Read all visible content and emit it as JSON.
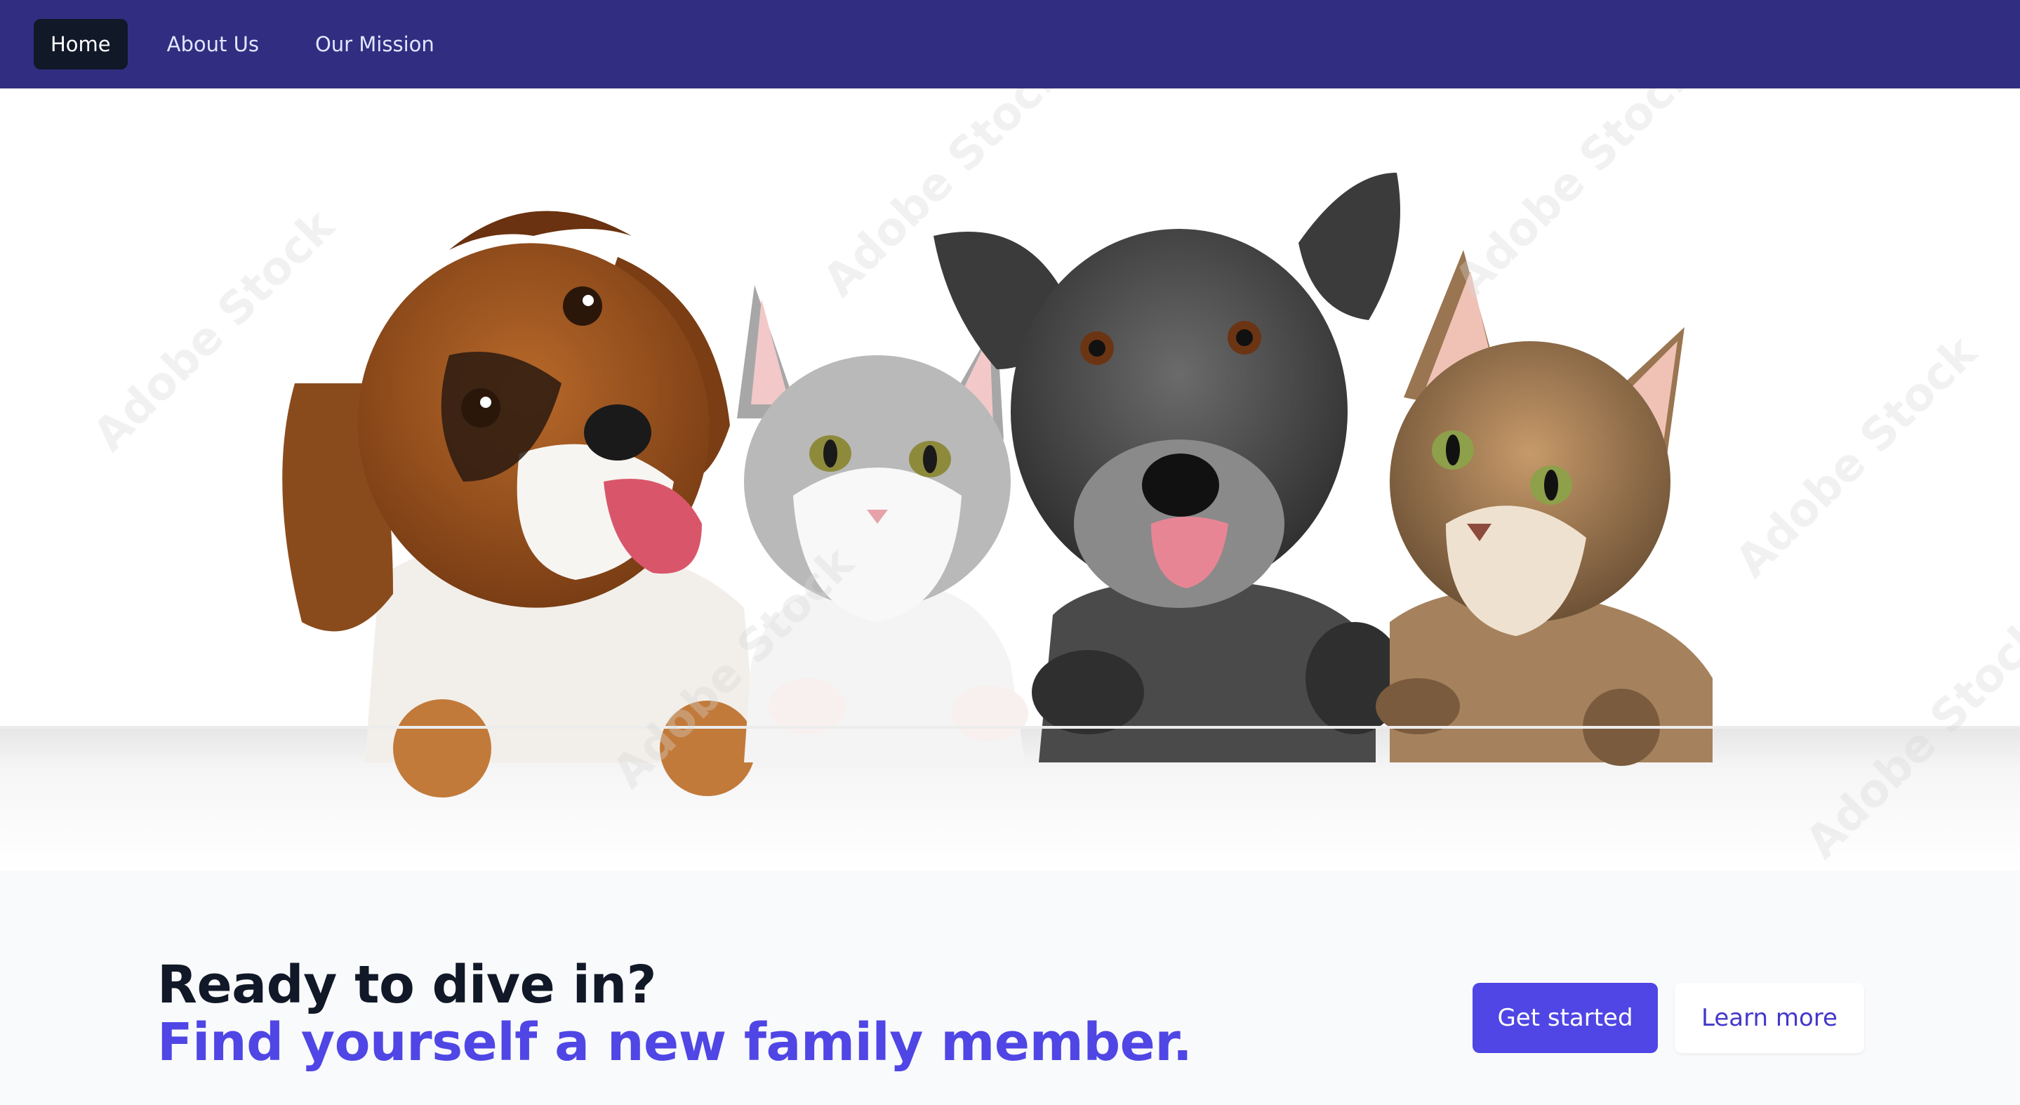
{
  "nav": {
    "items": [
      {
        "label": "Home",
        "active": true
      },
      {
        "label": "About Us",
        "active": false
      },
      {
        "label": "Our Mission",
        "active": false
      }
    ]
  },
  "hero": {
    "image_subject": "two dogs and two cats peeking over a white ledge",
    "watermark": "Adobe Stock"
  },
  "cta": {
    "heading_line1": "Ready to dive in?",
    "heading_line2": "Find yourself a new family member.",
    "primary_button": "Get started",
    "secondary_button": "Learn more"
  },
  "colors": {
    "nav_bg": "#312e81",
    "active_nav_bg": "#111827",
    "accent": "#4f46e5",
    "heading": "#111827"
  }
}
